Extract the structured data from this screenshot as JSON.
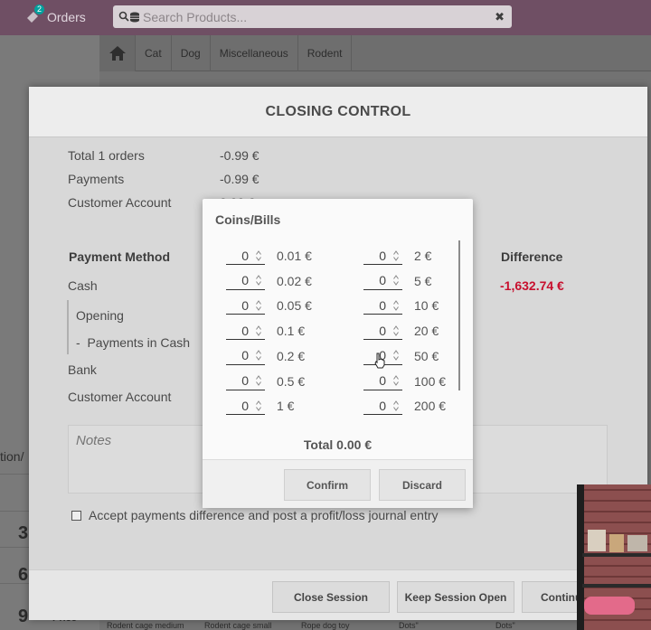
{
  "topbar": {
    "orders_label": "Orders",
    "orders_badge": "2",
    "search_placeholder": "Search Products...",
    "clear_icon": "✖"
  },
  "categories": [
    "Cat",
    "Dog",
    "Miscellaneous",
    "Rodent"
  ],
  "background": {
    "left_numbers": [
      "3",
      "6",
      "9"
    ],
    "left_fragment": "tion/",
    "product_captions": [
      "Rodent cage medium",
      "Rodent cage small",
      "Rope dog toy",
      "Dots\"",
      "Dots\"",
      "Price"
    ]
  },
  "modal": {
    "title": "CLOSING CONTROL",
    "summary": [
      {
        "label": "Total 1 orders",
        "value": "-0.99 €"
      },
      {
        "label": "Payments",
        "value": "-0.99 €"
      },
      {
        "label": "Customer Account",
        "value": "0.00 €"
      }
    ],
    "payment_method_header": "Payment Method",
    "difference_header": "Difference",
    "cash_label": "Cash",
    "cash_difference": "-1,632.74 €",
    "opening_label": "Opening",
    "payments_in_cash_label": "Payments in Cash",
    "bank_label": "Bank",
    "customer_account_label": "Customer Account",
    "notes_placeholder": "Notes",
    "accept_label": "Accept payments difference and post a profit/loss journal entry",
    "buttons": {
      "close_session": "Close Session",
      "keep_open": "Keep Session Open",
      "continue": "Continue"
    }
  },
  "coins": {
    "title": "Coins/Bills",
    "left": [
      {
        "qty": "0",
        "label": "0.01 €"
      },
      {
        "qty": "0",
        "label": "0.02 €"
      },
      {
        "qty": "0",
        "label": "0.05 €"
      },
      {
        "qty": "0",
        "label": "0.1 €"
      },
      {
        "qty": "0",
        "label": "0.2 €"
      },
      {
        "qty": "0",
        "label": "0.5 €"
      },
      {
        "qty": "0",
        "label": "1 €"
      }
    ],
    "right": [
      {
        "qty": "0",
        "label": "2 €"
      },
      {
        "qty": "0",
        "label": "5 €"
      },
      {
        "qty": "0",
        "label": "10 €"
      },
      {
        "qty": "0",
        "label": "20 €"
      },
      {
        "qty": "0",
        "label": "50 €"
      },
      {
        "qty": "0",
        "label": "100 €"
      },
      {
        "qty": "0",
        "label": "200 €"
      }
    ],
    "total": "Total 0.00 €",
    "confirm": "Confirm",
    "discard": "Discard"
  }
}
